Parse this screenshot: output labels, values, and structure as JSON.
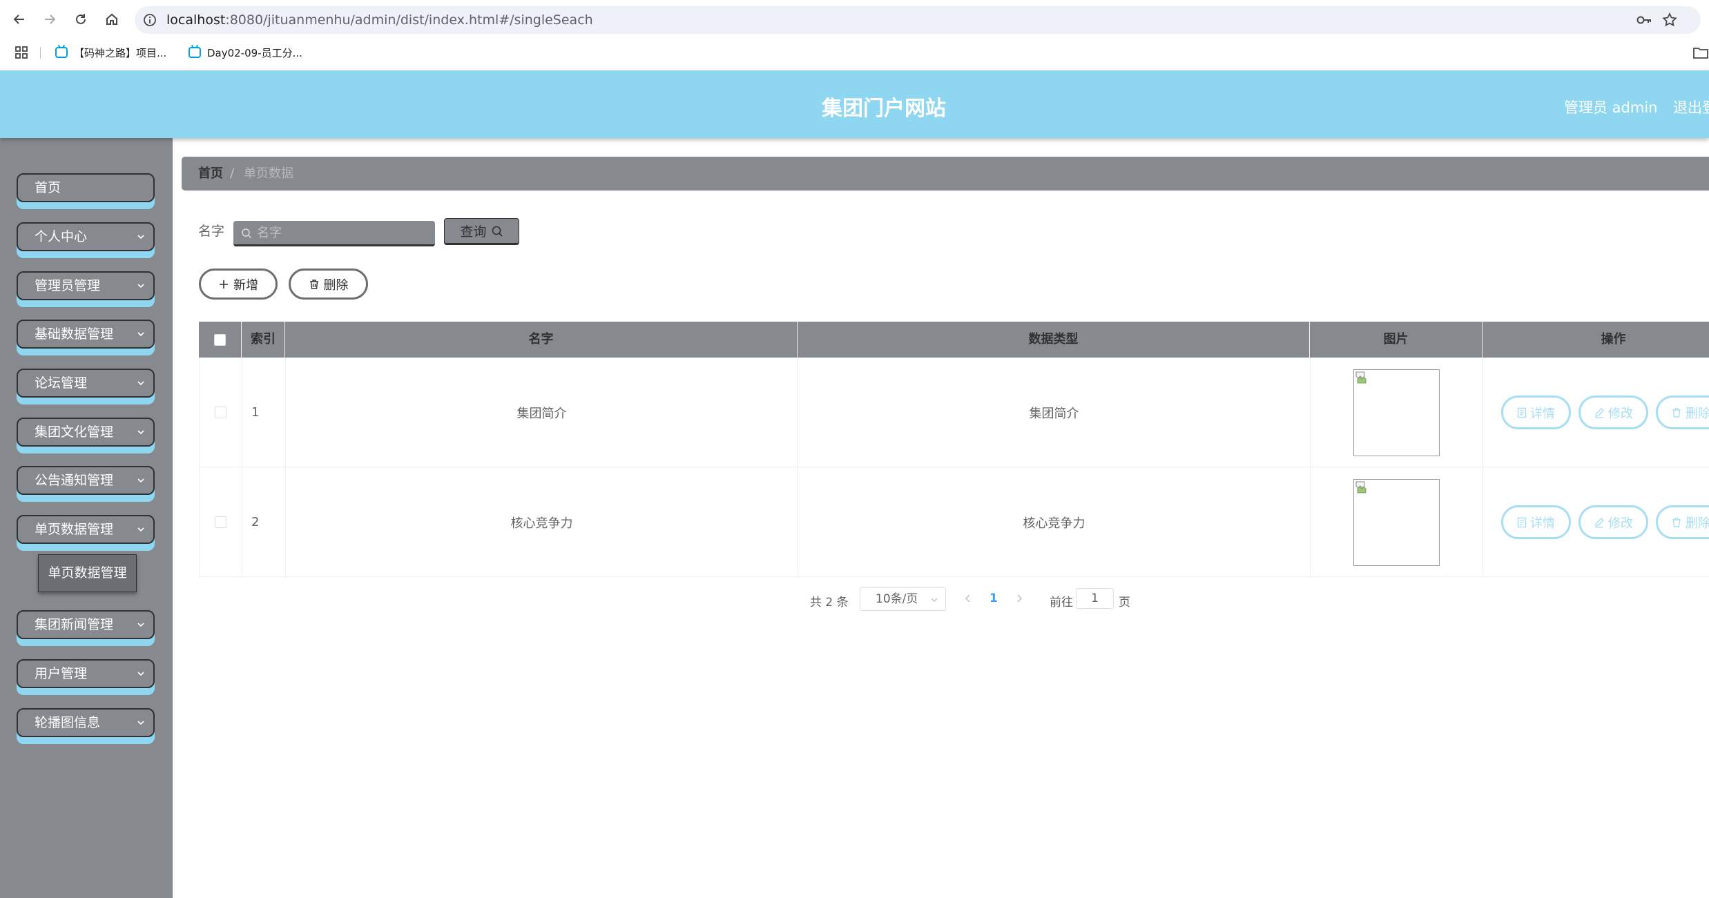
{
  "browser": {
    "url_host": "localhost",
    "url_rest": ":8080/jituanmenhu/admin/dist/index.html#/singleSeach",
    "bookmarks": [
      {
        "label": "【码神之路】项目..."
      },
      {
        "label": "Day02-09-员工分..."
      }
    ]
  },
  "header": {
    "title": "集团门户网站",
    "admin_label": "管理员 admin",
    "logout_label": "退出登录"
  },
  "sidebar": {
    "items": [
      {
        "label": "首页"
      },
      {
        "label": "个人中心"
      },
      {
        "label": "管理员管理"
      },
      {
        "label": "基础数据管理"
      },
      {
        "label": "论坛管理"
      },
      {
        "label": "集团文化管理"
      },
      {
        "label": "公告通知管理"
      },
      {
        "label": "单页数据管理"
      },
      {
        "label": "集团新闻管理"
      },
      {
        "label": "用户管理"
      },
      {
        "label": "轮播图信息"
      }
    ],
    "submenu": {
      "label": "单页数据管理"
    }
  },
  "breadcrumb": {
    "home": "首页",
    "separator": "/",
    "current": "单页数据"
  },
  "search": {
    "label": "名字",
    "placeholder": "名字",
    "button": "查询"
  },
  "actions": {
    "add": "新增",
    "delete": "删除"
  },
  "table": {
    "columns": [
      "索引",
      "名字",
      "数据类型",
      "图片",
      "操作"
    ],
    "rows": [
      {
        "index": "1",
        "name": "集团简介",
        "type": "集团简介"
      },
      {
        "index": "2",
        "name": "核心竞争力",
        "type": "核心竞争力"
      }
    ],
    "row_actions": {
      "detail": "详情",
      "edit": "修改",
      "delete": "删除"
    }
  },
  "pagination": {
    "total": "共 2 条",
    "page_size": "10条/页",
    "current_page": "1",
    "goto_label": "前往",
    "goto_value": "1",
    "page_suffix": "页"
  },
  "colors": {
    "header_bg": "#8fd7f1",
    "sidebar_bg": "#868a8e",
    "accent_light_blue": "#a8def3",
    "active_page": "#409eff"
  },
  "icons": [
    "back-icon",
    "forward-icon",
    "reload-icon",
    "home-icon",
    "site-info-icon",
    "key-icon",
    "star-icon",
    "apps-icon",
    "folder-icon",
    "search-icon",
    "plus-icon",
    "trash-icon",
    "chevron-down-icon",
    "document-icon",
    "edit-icon",
    "broken-image-icon"
  ]
}
